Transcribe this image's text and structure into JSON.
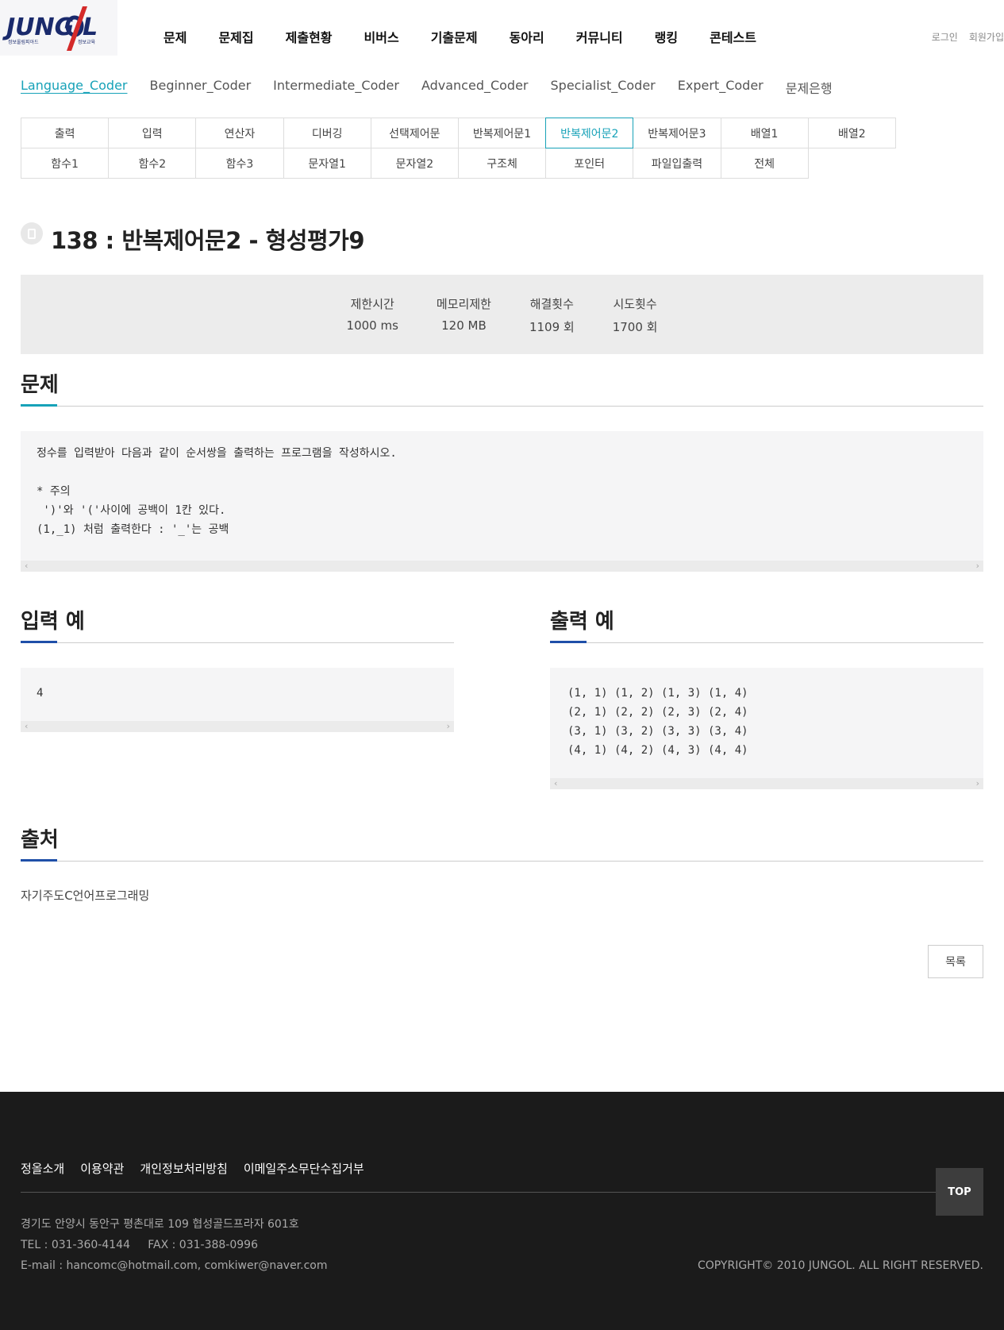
{
  "header": {
    "logo_text": "JUNGOL",
    "logo_sub": "정보올림피아드 정보교육",
    "nav": [
      "문제",
      "문제집",
      "제출현황",
      "비버스",
      "기출문제",
      "동아리",
      "커뮤니티",
      "랭킹",
      "콘테스트"
    ],
    "login": "로그인",
    "signup": "회원가입"
  },
  "level_tabs": [
    "Language_Coder",
    "Beginner_Coder",
    "Intermediate_Coder",
    "Advanced_Coder",
    "Specialist_Coder",
    "Expert_Coder",
    "문제은행"
  ],
  "categories_row1": [
    "출력",
    "입력",
    "연산자",
    "디버깅",
    "선택제어문",
    "반복제어문1",
    "반복제어문2",
    "반복제어문3",
    "배열1",
    "배열2"
  ],
  "categories_row2": [
    "함수1",
    "함수2",
    "함수3",
    "문자열1",
    "문자열2",
    "구조체",
    "포인터",
    "파일입출력",
    "전체"
  ],
  "problem": {
    "title": "138 : 반복제어문2 - 형성평가9",
    "stats": [
      {
        "label": "제한시간",
        "value": "1000 ms"
      },
      {
        "label": "메모리제한",
        "value": "120 MB"
      },
      {
        "label": "해결횟수",
        "value": "1109 회"
      },
      {
        "label": "시도횟수",
        "value": "1700 회"
      }
    ],
    "section_problem": "문제",
    "description": "정수를 입력받아 다음과 같이 순서쌍을 출력하는 프로그램을 작성하시오.\n\n* 주의\n ')'와 '('사이에 공백이 1칸 있다.\n(1,_1) 처럼 출력한다 : '_'는 공백",
    "section_input": "입력 예",
    "input_example": "4",
    "section_output": "출력 예",
    "output_example": "(1, 1) (1, 2) (1, 3) (1, 4)\n(2, 1) (2, 2) (2, 3) (2, 4)\n(3, 1) (3, 2) (3, 3) (3, 4)\n(4, 1) (4, 2) (4, 3) (4, 4)",
    "section_source": "출처",
    "source": "자기주도C언어프로그래밍",
    "list_button": "목록"
  },
  "footer": {
    "links": [
      "정올소개",
      "이용약관",
      "개인정보처리방침",
      "이메일주소무단수집거부"
    ],
    "top": "TOP",
    "address": "경기도 안양시 동안구 평촌대로 109 협성골드프라자 601호",
    "tel_fax": "TEL : 031-360-4144     FAX : 031-388-0996",
    "email": "E-mail : hancomc@hotmail.com, comkiwer@naver.com",
    "copyright": "COPYRIGHT© 2010 JUNGOL. ALL RIGHT RESERVED."
  },
  "colors": {
    "accent": "#17a2b8",
    "section_mark_blue": "#1f4fa8",
    "footer_bg": "#1b1b1b",
    "logo_navy": "#1a2a6c",
    "logo_red": "#d42a2a"
  }
}
